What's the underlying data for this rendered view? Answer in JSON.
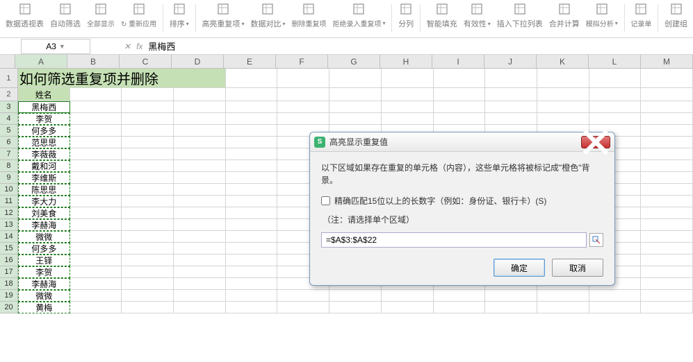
{
  "ribbon": {
    "items": [
      {
        "label": "数据透视表",
        "icon": "pivot"
      },
      {
        "label": "自动筛选",
        "icon": "filter"
      },
      {
        "label": "全部显示",
        "icon": "showall",
        "small": true
      },
      {
        "label": "重新应用",
        "icon": "reapply",
        "small": true,
        "prefix": "↻"
      },
      {
        "label": "排序",
        "icon": "sort",
        "drop": true
      },
      {
        "label": "高亮重复项",
        "icon": "highlight",
        "drop": true
      },
      {
        "label": "数据对比",
        "icon": "compare",
        "drop": true
      },
      {
        "label": "删除重复项",
        "icon": "dedupe",
        "small": true
      },
      {
        "label": "拒绝录入重复项",
        "icon": "reject",
        "small": true,
        "drop": true
      },
      {
        "label": "分列",
        "icon": "split"
      },
      {
        "label": "智能填充",
        "icon": "fill"
      },
      {
        "label": "有效性",
        "icon": "valid",
        "drop": true
      },
      {
        "label": "插入下拉列表",
        "icon": "dropdown"
      },
      {
        "label": "合并计算",
        "icon": "merge"
      },
      {
        "label": "模拟分析",
        "icon": "whatif",
        "small": true,
        "drop": true
      },
      {
        "label": "记录单",
        "icon": "form",
        "small": true
      },
      {
        "label": "创建组",
        "icon": "group"
      }
    ],
    "separators": [
      4,
      5,
      9,
      10,
      15,
      16
    ]
  },
  "name_box": "A3",
  "fx": "fx",
  "formula": "黑梅西",
  "columns": [
    "A",
    "B",
    "C",
    "D",
    "E",
    "F",
    "G",
    "H",
    "I",
    "J",
    "K",
    "L",
    "M"
  ],
  "title": "如何筛选重复项并删除",
  "header": "姓名",
  "rows": [
    "黑梅西",
    "李贺",
    "何多多",
    "范思思",
    "李薇薇",
    "戴和河",
    "李维斯",
    "陈思思",
    "李大力",
    "刘美食",
    "李赫海",
    "微微",
    "何多多",
    "王铎",
    "李贺",
    "李赫海",
    "微微",
    "黄梅"
  ],
  "row_numbers": [
    "1",
    "2",
    "3",
    "4",
    "5",
    "6",
    "7",
    "8",
    "9",
    "10",
    "11",
    "12",
    "13",
    "14",
    "15",
    "16",
    "17",
    "18",
    "19",
    "20"
  ],
  "dialog": {
    "title": "高亮显示重复值",
    "msg": "以下区域如果存在重复的单元格（内容），这些单元格将被标记成\"橙色\"背景。",
    "check_label": "精确匹配15位以上的长数字（例如：身份证、银行卡）(S)",
    "note": "（注：请选择单个区域）",
    "range": "=$A$3:$A$22",
    "ok": "确定",
    "cancel": "取消"
  }
}
